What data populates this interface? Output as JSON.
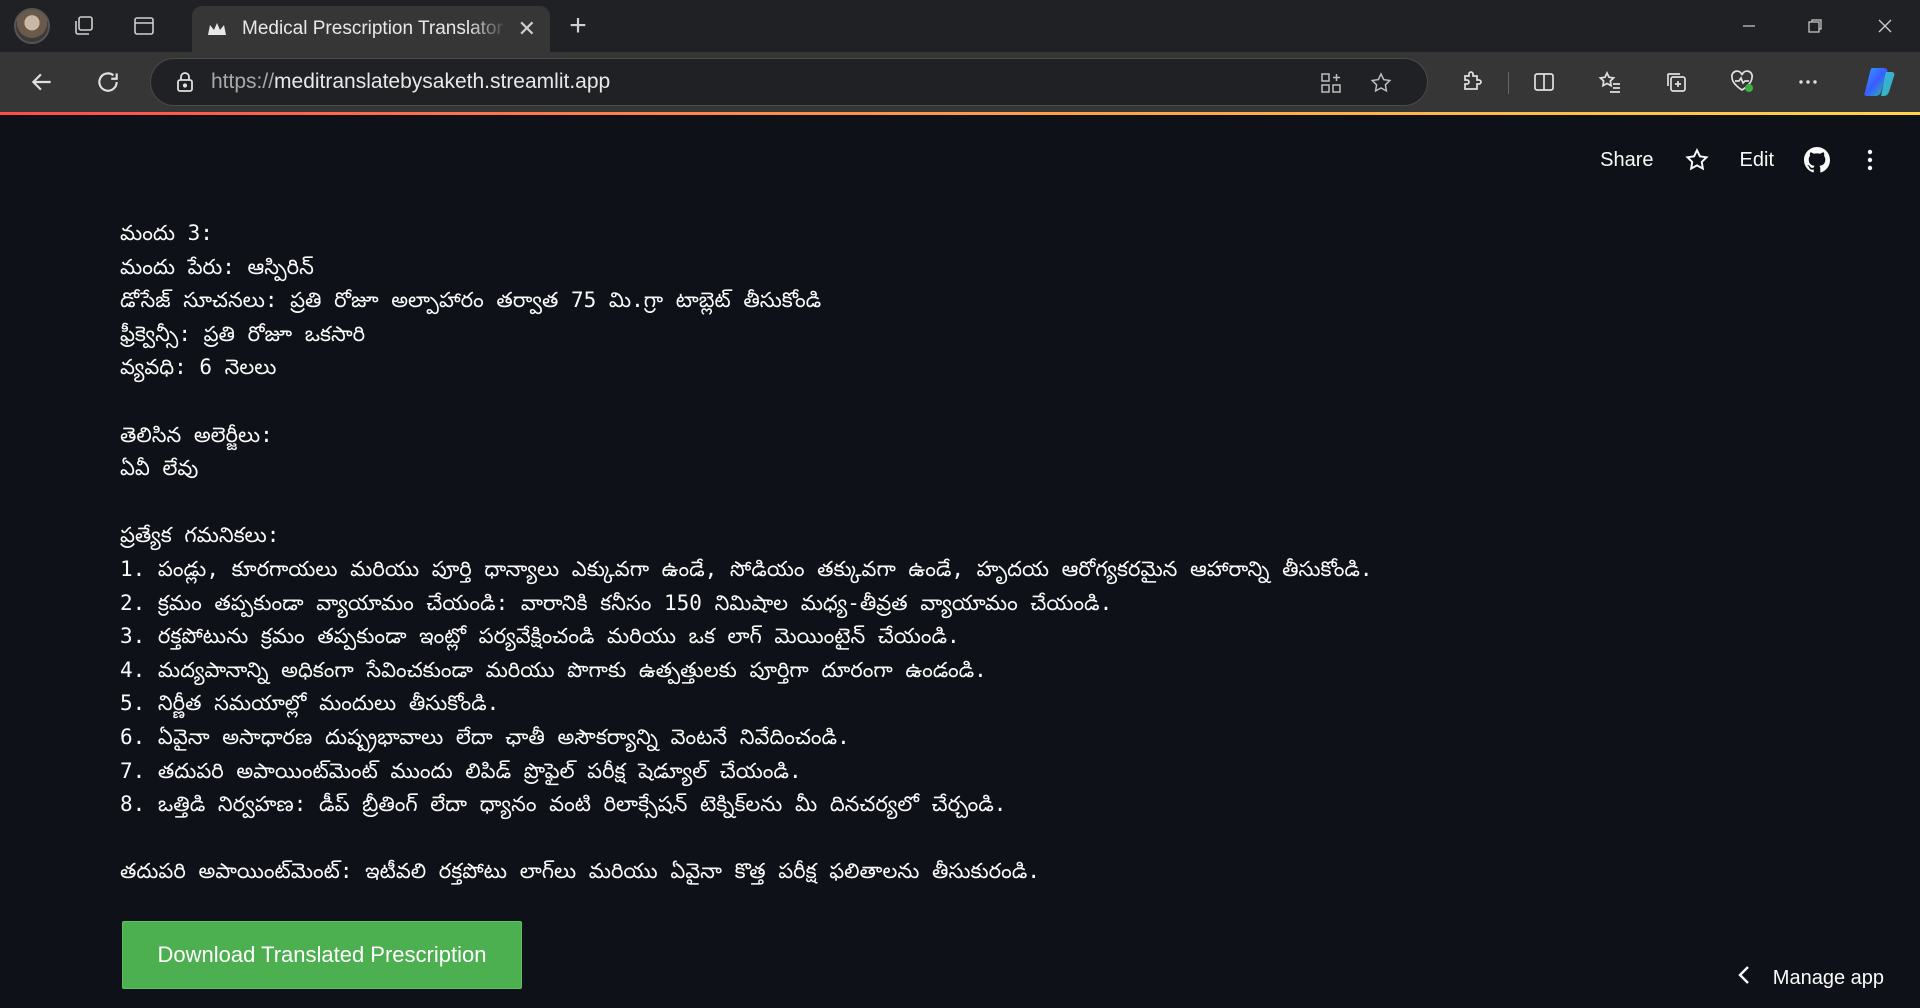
{
  "browser": {
    "tab_title": "Medical Prescription Translator · Streamlit",
    "url_scheme": "https://",
    "url_host": "meditranslatebysaketh.streamlit.app"
  },
  "app_header": {
    "share": "Share",
    "edit": "Edit"
  },
  "content": {
    "lines": [
      "మందు 3:",
      "మందు పేరు: ఆస్పిరిన్",
      "డోసేజ్ సూచనలు: ప్రతి రోజూ అల్పాహారం తర్వాత 75 మి.గ్రా టాబ్లెట్ తీసుకోండి",
      "ఫ్రీక్వెన్సీ: ప్రతి రోజూ ఒకసారి",
      "వ్యవధి: 6 నెలలు",
      "",
      "తెలిసిన అలెర్జీలు:",
      "ఏవీ లేవు",
      "",
      "ప్రత్యేక గమనికలు:",
      "1. పండ్లు, కూరగాయలు మరియు పూర్తి ధాన్యాలు ఎక్కువగా ఉండే, సోడియం తక్కువగా ఉండే, హృదయ ఆరోగ్యకరమైన ఆహారాన్ని తీసుకోండి.",
      "2. క్రమం తప్పకుండా వ్యాయామం చేయండి: వారానికి కనీసం 150 నిమిషాల మధ్య-తీవ్రత వ్యాయామం చేయండి.",
      "3. రక్తపోటును క్రమం తప్పకుండా ఇంట్లో పర్యవేక్షించండి మరియు ఒక లాగ్ మెయింటైన్ చేయండి.",
      "4. మద్యపానాన్ని అధికంగా సేవించకుండా మరియు పొగాకు ఉత్పత్తులకు పూర్తిగా దూరంగా ఉండండి.",
      "5. నిర్ణీత సమయాల్లో మందులు తీసుకోండి.",
      "6. ఏవైనా అసాధారణ దుష్ప్రభావాలు లేదా ఛాతీ అసౌకర్యాన్ని వెంటనే నివేదించండి.",
      "7. తదుపరి అపాయింట్‌మెంట్ ముందు లిపిడ్ ప్రొఫైల్ పరీక్ష షెడ్యూల్ చేయండి.",
      "8. ఒత్తిడి నిర్వహణ: డీప్ బ్రీతింగ్ లేదా ధ్యానం వంటి రిలాక్సేషన్ టెక్నిక్‌లను మీ దినచర్యలో చేర్చండి.",
      "",
      "తదుపరి అపాయింట్‌మెంట్: ఇటీవలి రక్తపోటు లాగ్‌లు మరియు ఏవైనా కొత్త పరీక్ష ఫలితాలను తీసుకురండి."
    ]
  },
  "download_button": "Download Translated Prescription",
  "manage_app": "Manage app",
  "colors": {
    "app_bg": "#0e1117",
    "button_green": "#4caf50",
    "text": "#fafafa"
  }
}
